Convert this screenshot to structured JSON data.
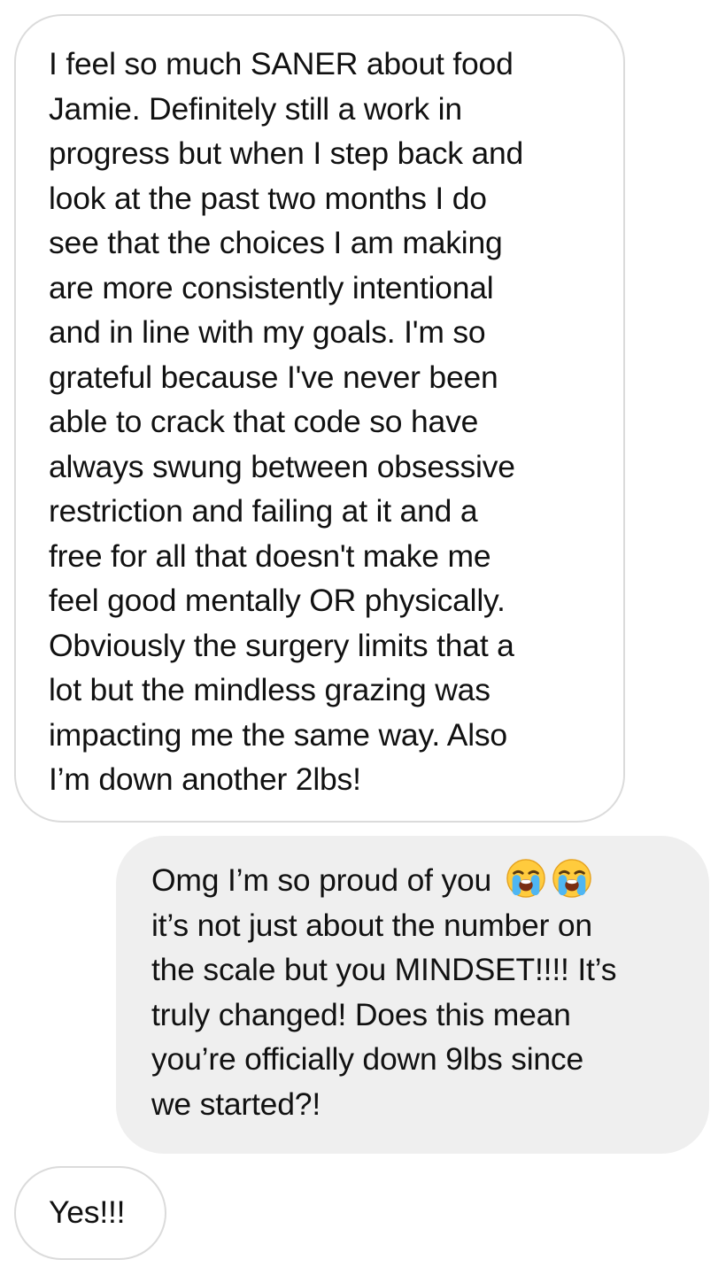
{
  "messages": [
    {
      "id": "msg1",
      "direction": "incoming",
      "lines": [
        "I feel so much SANER about food",
        "Jamie. Definitely still a work in",
        "progress but when I step back and",
        "look at the past two months I do",
        "see that the choices I am making",
        "are more consistently intentional",
        "and in line with my goals. I'm so",
        "grateful because I've never been",
        "able to crack that code so have",
        "always swung between obsessive",
        "restriction and failing at it and a",
        "free for all that doesn't make me",
        "feel good mentally OR physically.",
        "Obviously the surgery limits that a",
        "lot but the mindless grazing was",
        "impacting me the same way. Also",
        "I’m down another 2lbs!"
      ]
    },
    {
      "id": "msg2",
      "direction": "outgoing",
      "lines": [
        "Omg I’m so proud of you",
        "it’s not just about the number on",
        "the scale but you MINDSET!!!! It’s",
        "truly changed! Does this mean",
        "you’re officially down 9lbs since",
        "we started?!"
      ],
      "emojis": [
        "loudly-crying-face-icon",
        "loudly-crying-face-icon"
      ]
    },
    {
      "id": "msg3",
      "direction": "incoming",
      "lines": [
        "Yes!!!"
      ]
    }
  ],
  "colors": {
    "incoming_bg": "#ffffff",
    "incoming_border": "#dbdbdb",
    "outgoing_bg": "#efefef",
    "text": "#111111"
  }
}
